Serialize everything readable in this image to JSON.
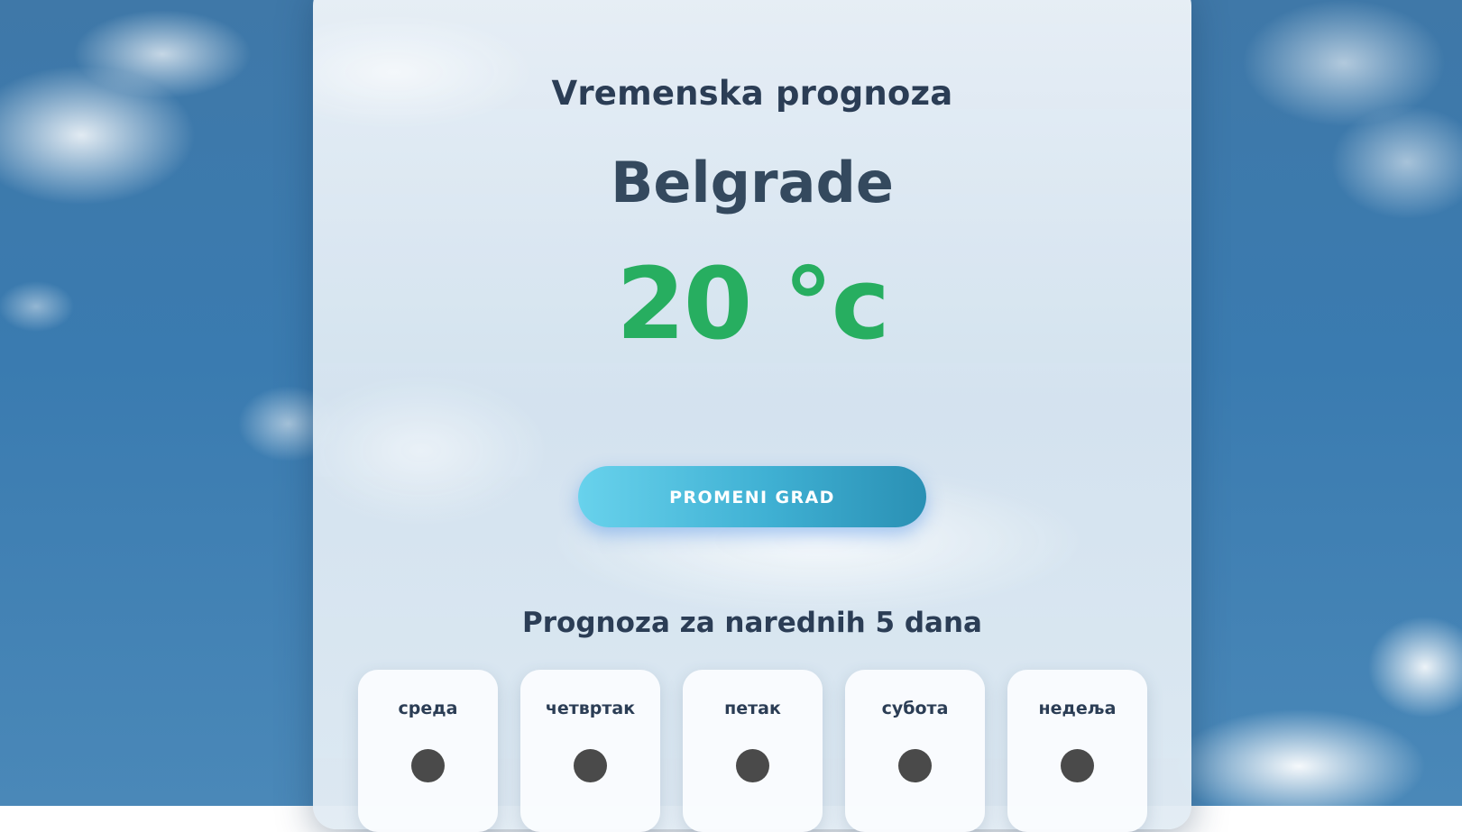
{
  "app": {
    "title": "Vremenska prognoza",
    "city": "Belgrade",
    "temperature": "20 °c",
    "accent_color": "#27ae60"
  },
  "actions": {
    "change_city_label": "PROMENI GRAD"
  },
  "forecast": {
    "title": "Prognoza za narednih 5 dana",
    "days": [
      {
        "name": "среда",
        "icon": "weather-icon-placeholder"
      },
      {
        "name": "четвртак",
        "icon": "weather-icon-placeholder"
      },
      {
        "name": "петак",
        "icon": "weather-icon-placeholder"
      },
      {
        "name": "субота",
        "icon": "weather-icon-placeholder"
      },
      {
        "name": "недеља",
        "icon": "weather-icon-placeholder"
      }
    ]
  }
}
